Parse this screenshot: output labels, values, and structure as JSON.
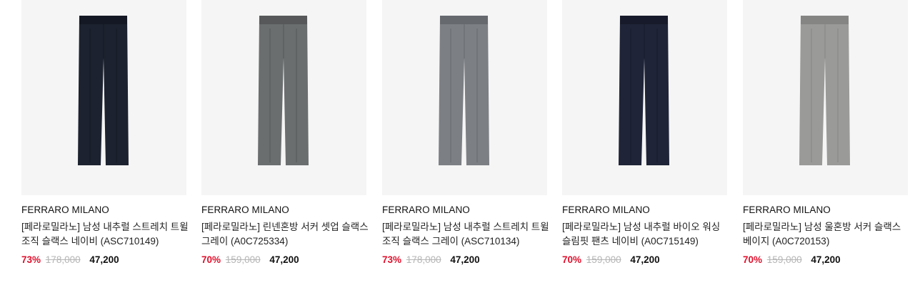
{
  "products": [
    {
      "brand": "FERRARO MILANO",
      "name": "[페라로밀라노] 남성 내추럴 스트레치 트윌 조직 슬랙스 네이비 (ASC710149)",
      "discount": "73%",
      "original_price": "178,000",
      "sale_price": "47,200",
      "pant_color": "#1d2230",
      "pant_shade": "#141824"
    },
    {
      "brand": "FERRARO MILANO",
      "name": "[페라로밀라노] 린넨혼방 서커 셋업 슬랙스 그레이 (A0C725334)",
      "discount": "70%",
      "original_price": "159,000",
      "sale_price": "47,200",
      "pant_color": "#6b6e6f",
      "pant_shade": "#565859"
    },
    {
      "brand": "FERRARO MILANO",
      "name": "[페라로밀라노] 남성 내추럴 스트레치 트윌 조직 슬랙스 그레이 (ASC710134)",
      "discount": "73%",
      "original_price": "178,000",
      "sale_price": "47,200",
      "pant_color": "#7c7f84",
      "pant_shade": "#66696e"
    },
    {
      "brand": "FERRARO MILANO",
      "name": "[페라로밀라노] 남성 내추럴 바이오 워싱 슬림핏 팬츠 네이비 (A0C715149)",
      "discount": "70%",
      "original_price": "159,000",
      "sale_price": "47,200",
      "pant_color": "#1f2438",
      "pant_shade": "#161a2a"
    },
    {
      "brand": "FERRARO MILANO",
      "name": "[페라로밀라노] 남성 울혼방 서커 슬랙스 베이지 (A0C720153)",
      "discount": "70%",
      "original_price": "159,000",
      "sale_price": "47,200",
      "pant_color": "#9a9a98",
      "pant_shade": "#858583"
    }
  ]
}
